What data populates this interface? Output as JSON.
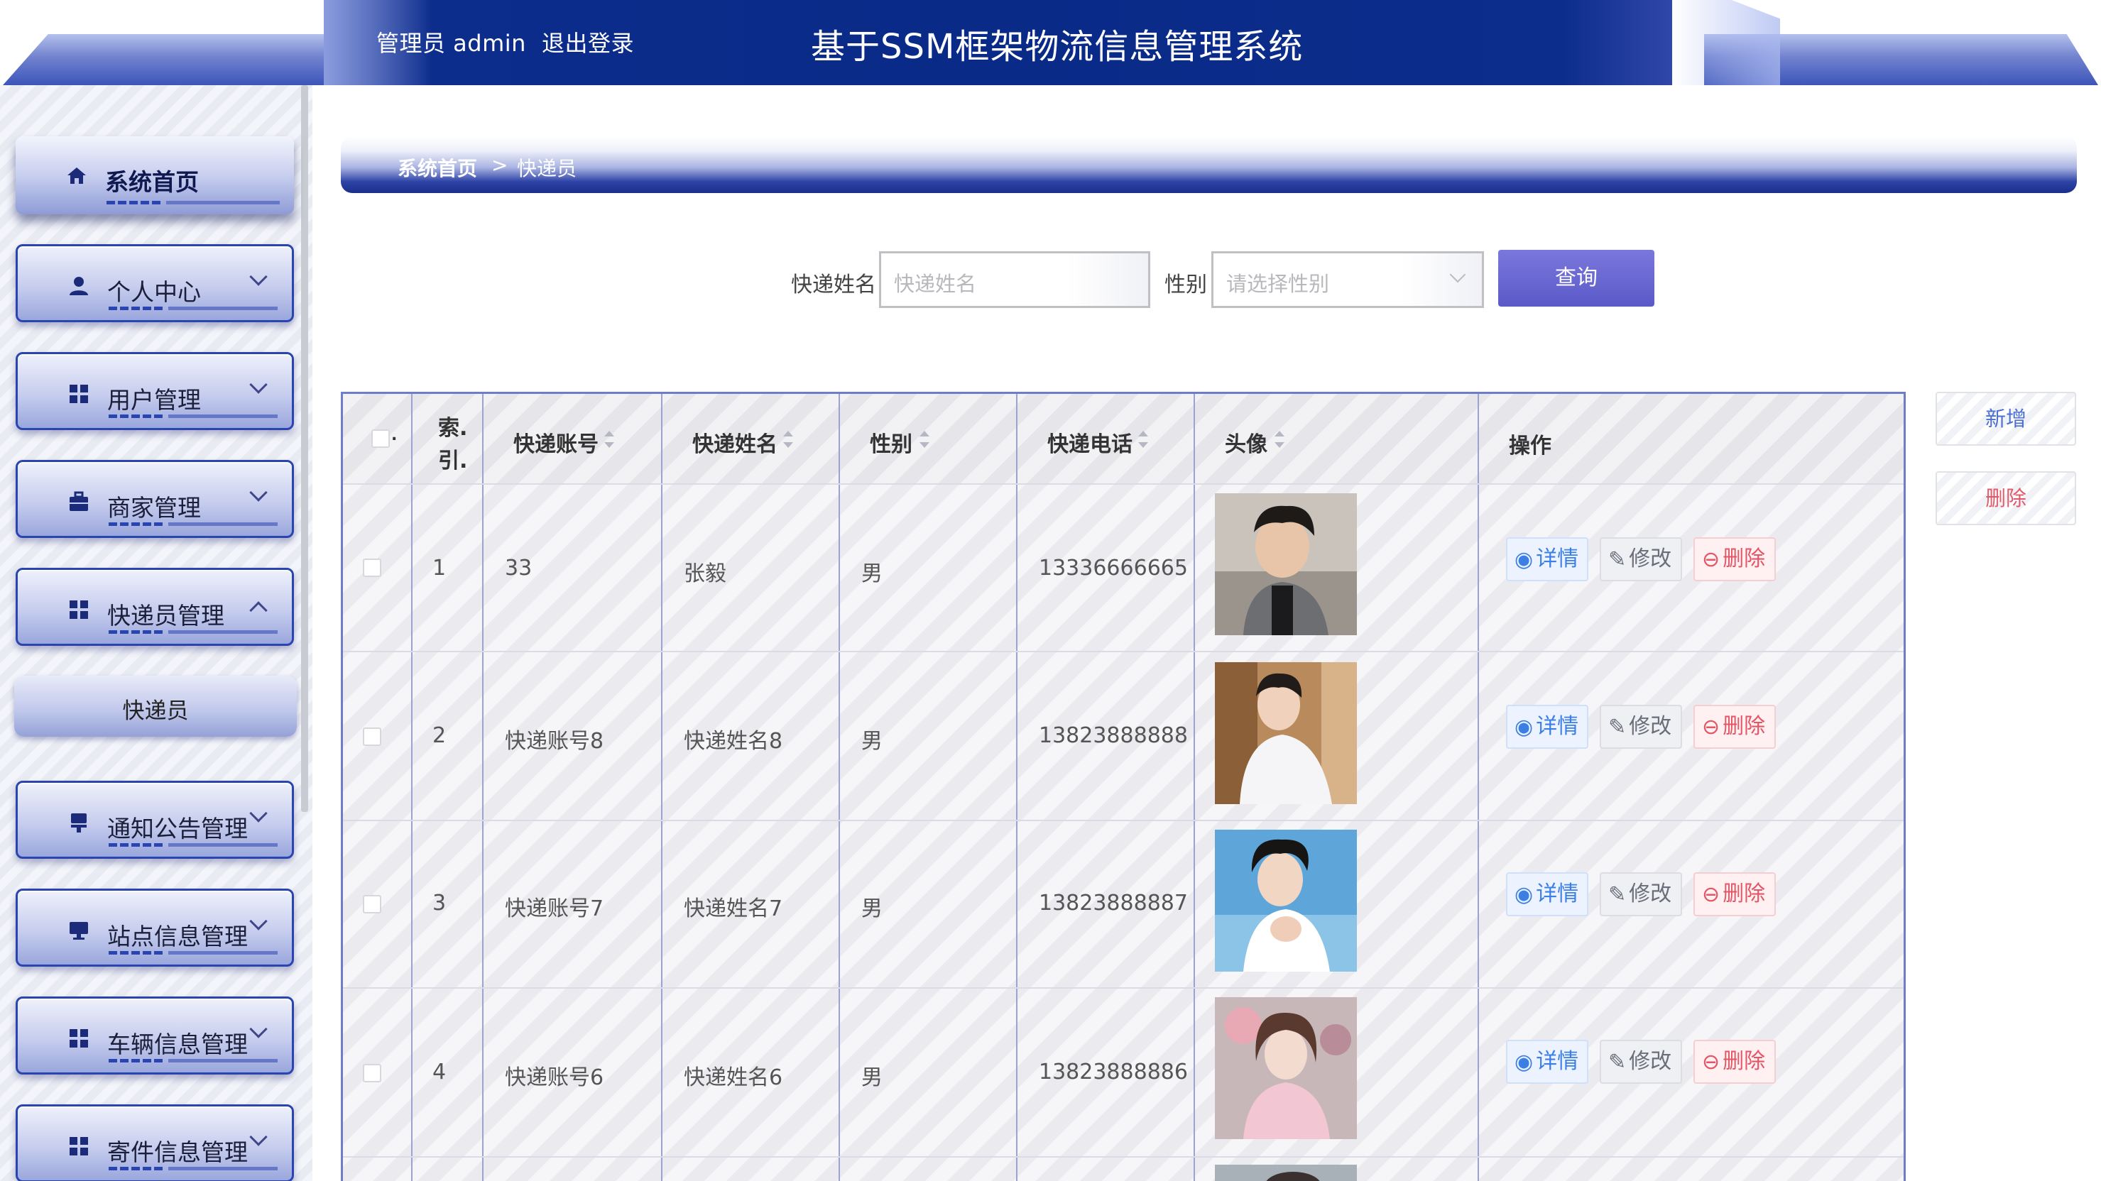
{
  "header": {
    "user_label": "管理员 admin",
    "logout_label": "退出登录",
    "title": "基于SSM框架物流信息管理系统"
  },
  "sidebar": {
    "items": [
      {
        "label": "系统首页",
        "icon": "home-icon",
        "active": true
      },
      {
        "label": "个人中心",
        "icon": "person-icon"
      },
      {
        "label": "用户管理",
        "icon": "grid-icon"
      },
      {
        "label": "商家管理",
        "icon": "shop-icon"
      },
      {
        "label": "快递员管理",
        "icon": "grid-icon",
        "expanded": true
      },
      {
        "label": "通知公告管理",
        "icon": "notice-icon"
      },
      {
        "label": "站点信息管理",
        "icon": "monitor-icon"
      },
      {
        "label": "车辆信息管理",
        "icon": "grid-icon"
      },
      {
        "label": "寄件信息管理",
        "icon": "grid-icon"
      }
    ],
    "submenu": {
      "label": "快递员"
    }
  },
  "breadcrumb": {
    "home": "系统首页",
    "separator": ">",
    "current": "快递员"
  },
  "search": {
    "name_label": "快递姓名",
    "name_placeholder": "快递姓名",
    "gender_label": "性别",
    "gender_placeholder": "请选择性别",
    "query_button": "查询"
  },
  "actions": {
    "add": "新增",
    "delete": "删除"
  },
  "table": {
    "columns": {
      "index": "索引.",
      "account": "快递账号",
      "name": "快递姓名",
      "gender": "性别",
      "phone": "快递电话",
      "avatar": "头像",
      "ops": "操作"
    },
    "index_line1": "索.",
    "index_line2": "引.",
    "row_ops": {
      "detail": "详情",
      "edit": "修改",
      "remove": "删除"
    },
    "rows": [
      {
        "index": "1",
        "account": "33",
        "name": "张毅",
        "gender": "男",
        "phone": "13336666665"
      },
      {
        "index": "2",
        "account": "快递账号8",
        "name": "快递姓名8",
        "gender": "男",
        "phone": "13823888888"
      },
      {
        "index": "3",
        "account": "快递账号7",
        "name": "快递姓名7",
        "gender": "男",
        "phone": "13823888887"
      },
      {
        "index": "4",
        "account": "快递账号6",
        "name": "快递姓名6",
        "gender": "男",
        "phone": "13823888886"
      }
    ]
  },
  "colors": {
    "header_blue": "#0a2a88",
    "menu_border": "#2b45b0",
    "query_button": "#5b59c8",
    "detail_blue": "#3b7fe6",
    "remove_red": "#e45565"
  }
}
